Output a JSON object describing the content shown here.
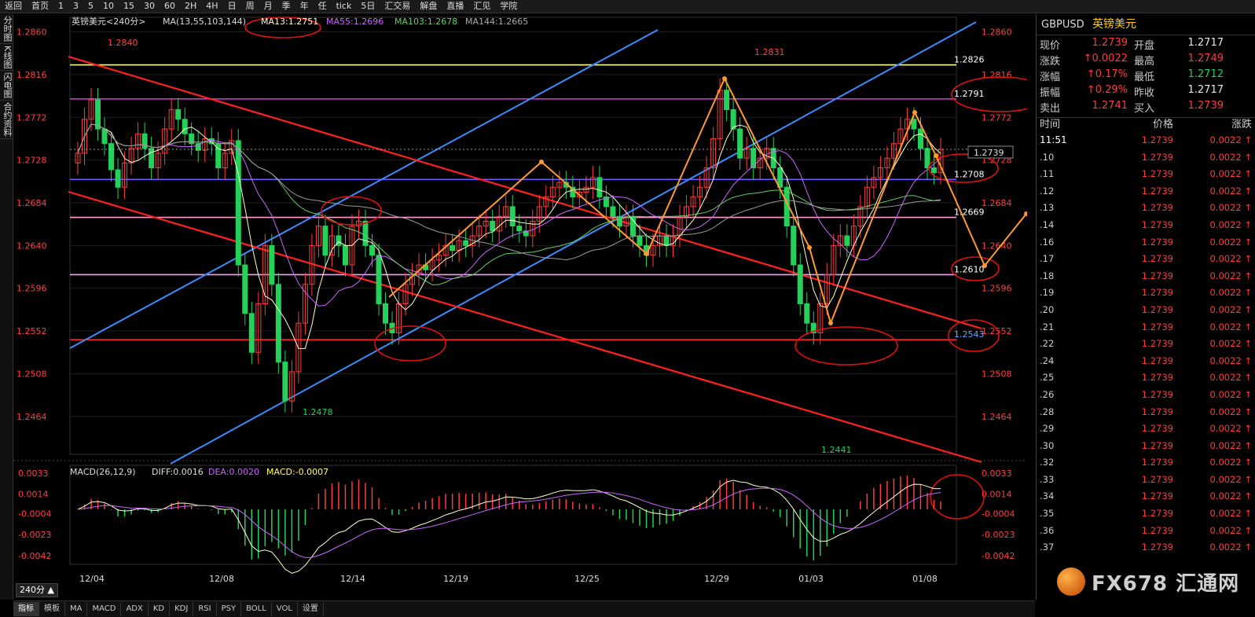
{
  "toolbar": {
    "items": [
      "返回",
      "首页",
      "1",
      "3",
      "5",
      "10",
      "15",
      "30",
      "60",
      "2H",
      "4H",
      "日",
      "周",
      "月",
      "季",
      "年",
      "任",
      "tick",
      "5日",
      "汇交易",
      "解盘",
      "直播",
      "汇见",
      "学院"
    ]
  },
  "leftbar": {
    "items": [
      "分时图",
      "K线图",
      "闪电图",
      "合约资料"
    ]
  },
  "chart": {
    "title": "英镑美元<240分>",
    "ma_label": "MA(13,55,103,144)",
    "ma13": "MA13:1.2751",
    "ma55": "MA55:1.2696",
    "ma103": "MA103:1.2678",
    "ma144": "MA144:1.2665",
    "period_label": "240分 ▲",
    "current_price_box": "1.2739",
    "macd_label": "MACD(26,12,9)",
    "macd_diff": "DIFF:0.0016",
    "macd_dea": "DEA:0.0020",
    "macd_val": "MACD:-0.0007"
  },
  "chart_data": {
    "type": "candlestick",
    "y_ticks": [
      "1.2860",
      "1.2816",
      "1.2772",
      "1.2728",
      "1.2684",
      "1.2640",
      "1.2596",
      "1.2552",
      "1.2508",
      "1.2464"
    ],
    "ylim": [
      1.2425,
      1.2875
    ],
    "x_ticks": [
      "12/04",
      "12/08",
      "12/14",
      "12/19",
      "12/25",
      "12/29",
      "01/03",
      "01/08"
    ],
    "annotations": [
      {
        "text": "1.2840",
        "value": 1.284
      },
      {
        "text": "1.2478",
        "value": 1.2478
      },
      {
        "text": "1.2831",
        "value": 1.2831
      },
      {
        "text": "1.2441",
        "value": 1.2441
      }
    ],
    "hlines": [
      {
        "label": "1.2826",
        "value": 1.2826,
        "color": "#ffff99"
      },
      {
        "label": "1.2791",
        "value": 1.2791,
        "color": "#cc33cc"
      },
      {
        "label": "1.2708",
        "value": 1.2708,
        "color": "#6a5cff"
      },
      {
        "label": "1.2669",
        "value": 1.2669,
        "color": "#ff99cc"
      },
      {
        "label": "1.2610",
        "value": 1.261,
        "color": "#ff99ff"
      },
      {
        "label": "1.2543",
        "value": 1.2543,
        "color": "#ff2020"
      }
    ],
    "macd_ticks": [
      "0.0033",
      "0.0014",
      "-0.0004",
      "-0.0023",
      "-0.0042"
    ],
    "macd_ylim": [
      -0.005,
      0.004
    ],
    "closes": [
      1.2735,
      1.277,
      1.279,
      1.276,
      1.2745,
      1.2718,
      1.27,
      1.2725,
      1.274,
      1.2755,
      1.274,
      1.272,
      1.2735,
      1.276,
      1.278,
      1.277,
      1.2755,
      1.2745,
      1.2738,
      1.275,
      1.2745,
      1.272,
      1.2735,
      1.2748,
      1.262,
      1.257,
      1.253,
      1.258,
      1.264,
      1.26,
      1.252,
      1.248,
      1.251,
      1.256,
      1.26,
      1.264,
      1.266,
      1.263,
      1.265,
      1.264,
      1.262,
      1.266,
      1.2665,
      1.264,
      1.263,
      1.258,
      1.256,
      1.255,
      1.258,
      1.26,
      1.261,
      1.262,
      1.2615,
      1.2625,
      1.263,
      1.264,
      1.2635,
      1.2645,
      1.264,
      1.265,
      1.266,
      1.2665,
      1.2655,
      1.267,
      1.268,
      1.266,
      1.2655,
      1.265,
      1.2665,
      1.268,
      1.269,
      1.27,
      1.2705,
      1.27,
      1.269,
      1.2695,
      1.27,
      1.271,
      1.269,
      1.268,
      1.267,
      1.266,
      1.267,
      1.265,
      1.264,
      1.263,
      1.264,
      1.265,
      1.264,
      1.265,
      1.267,
      1.268,
      1.269,
      1.27,
      1.272,
      1.275,
      1.28,
      1.278,
      1.276,
      1.273,
      1.274,
      1.272,
      1.273,
      1.274,
      1.272,
      1.27,
      1.266,
      1.262,
      1.258,
      1.256,
      1.255,
      1.258,
      1.261,
      1.264,
      1.265,
      1.264,
      1.266,
      1.268,
      1.27,
      1.271,
      1.272,
      1.273,
      1.2745,
      1.276,
      1.277,
      1.276,
      1.274,
      1.272,
      1.2715,
      1.2739
    ]
  },
  "panel": {
    "symbol": "GBPUSD",
    "name": "英镑美元",
    "quote": [
      {
        "label": "现价",
        "value": "1.2739",
        "green": false
      },
      {
        "label": "开盘",
        "value": "1.2717",
        "green": false,
        "white": true
      },
      {
        "label": "涨跌",
        "value": "↑0.0022",
        "green": false
      },
      {
        "label": "最高",
        "value": "1.2749",
        "green": false
      },
      {
        "label": "涨幅",
        "value": "↑0.17%",
        "green": false
      },
      {
        "label": "最低",
        "value": "1.2712",
        "green": true
      },
      {
        "label": "振幅",
        "value": "↑0.29%",
        "green": false
      },
      {
        "label": "昨收",
        "value": "1.2717",
        "green": false,
        "white": true
      },
      {
        "label": "卖出",
        "value": "1.2741",
        "green": false
      },
      {
        "label": "买入",
        "value": "1.2739",
        "green": false
      }
    ],
    "headers": {
      "time": "时间",
      "price": "价格",
      "change": "涨跌"
    },
    "ticks": [
      {
        "time": "11:51",
        "price": "1.2739",
        "change": "0.0022 ↑"
      },
      {
        "time": ".10",
        "price": "1.2739",
        "change": "0.0022 ↑"
      },
      {
        "time": ".11",
        "price": "1.2739",
        "change": "0.0022 ↑"
      },
      {
        "time": ".12",
        "price": "1.2739",
        "change": "0.0022 ↑"
      },
      {
        "time": ".13",
        "price": "1.2739",
        "change": "0.0022 ↑"
      },
      {
        "time": ".14",
        "price": "1.2739",
        "change": "0.0022 ↑"
      },
      {
        "time": ".16",
        "price": "1.2739",
        "change": "0.0022 ↑"
      },
      {
        "time": ".17",
        "price": "1.2739",
        "change": "0.0022 ↑"
      },
      {
        "time": ".18",
        "price": "1.2739",
        "change": "0.0022 ↑"
      },
      {
        "time": ".19",
        "price": "1.2739",
        "change": "0.0022 ↑"
      },
      {
        "time": ".20",
        "price": "1.2739",
        "change": "0.0022 ↑"
      },
      {
        "time": ".21",
        "price": "1.2739",
        "change": "0.0022 ↑"
      },
      {
        "time": ".22",
        "price": "1.2739",
        "change": "0.0022 ↑"
      },
      {
        "time": ".24",
        "price": "1.2739",
        "change": "0.0022 ↑"
      },
      {
        "time": ".25",
        "price": "1.2739",
        "change": "0.0022 ↑"
      },
      {
        "time": ".26",
        "price": "1.2739",
        "change": "0.0022 ↑"
      },
      {
        "time": ".28",
        "price": "1.2739",
        "change": "0.0022 ↑"
      },
      {
        "time": ".29",
        "price": "1.2739",
        "change": "0.0022 ↑"
      },
      {
        "time": ".30",
        "price": "1.2739",
        "change": "0.0022 ↑"
      },
      {
        "time": ".32",
        "price": "1.2739",
        "change": "0.0022 ↑"
      },
      {
        "time": ".33",
        "price": "1.2739",
        "change": "0.0022 ↑"
      },
      {
        "time": ".34",
        "price": "1.2739",
        "change": "0.0022 ↑"
      },
      {
        "time": ".35",
        "price": "1.2739",
        "change": "0.0022 ↑"
      },
      {
        "time": ".36",
        "price": "1.2739",
        "change": "0.0022 ↑"
      },
      {
        "time": ".37",
        "price": "1.2739",
        "change": "0.0022 ↑"
      }
    ]
  },
  "bottombar": {
    "items": [
      "指标",
      "模板",
      "MA",
      "MACD",
      "ADX",
      "KD",
      "KDJ",
      "RSI",
      "PSY",
      "BOLL",
      "VOL",
      "设置"
    ]
  },
  "logo": {
    "text": "FX678 汇通网"
  },
  "colors": {
    "up": "#ff3b3b",
    "down": "#25d158",
    "channel": "#3b8cff",
    "trend": "#ff2020",
    "arrow": "#ff9a2e"
  }
}
